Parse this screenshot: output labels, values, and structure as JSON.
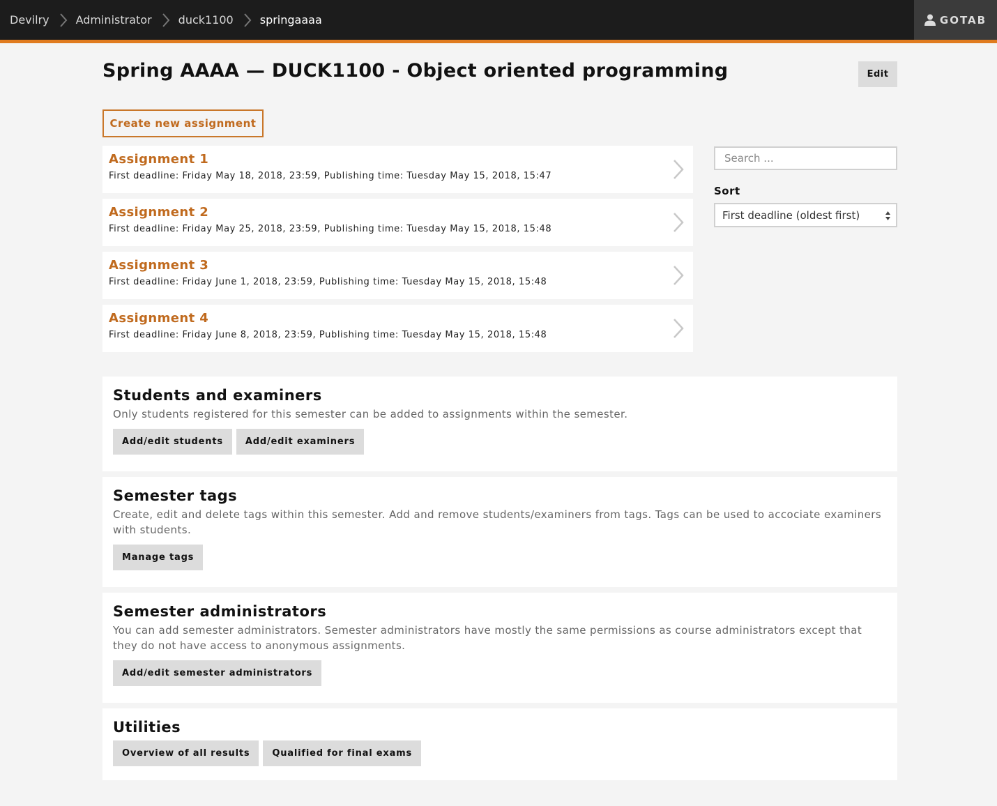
{
  "breadcrumbs": [
    {
      "label": "Devilry"
    },
    {
      "label": "Administrator"
    },
    {
      "label": "duck1100"
    },
    {
      "label": "springaaaa"
    }
  ],
  "user": {
    "label": "GOTAB",
    "icon": "user-icon"
  },
  "page": {
    "title": "Spring AAAA — DUCK1100 - Object oriented programming",
    "edit_label": "Edit",
    "create_label": "Create new assignment"
  },
  "assignments": [
    {
      "title": "Assignment 1",
      "meta": "First deadline: Friday May 18, 2018, 23:59, Publishing time: Tuesday May 15, 2018, 15:47"
    },
    {
      "title": "Assignment 2",
      "meta": "First deadline: Friday May 25, 2018, 23:59, Publishing time: Tuesday May 15, 2018, 15:48"
    },
    {
      "title": "Assignment 3",
      "meta": "First deadline: Friday June 1, 2018, 23:59, Publishing time: Tuesday May 15, 2018, 15:48"
    },
    {
      "title": "Assignment 4",
      "meta": "First deadline: Friday June 8, 2018, 23:59, Publishing time: Tuesday May 15, 2018, 15:48"
    }
  ],
  "sidebar": {
    "search_placeholder": "Search ...",
    "sort_label": "Sort",
    "sort_value": "First deadline (oldest first)"
  },
  "sections": {
    "students": {
      "title": "Students and examiners",
      "text": "Only students registered for this semester can be added to assignments within the semester.",
      "buttons": [
        "Add/edit students",
        "Add/edit examiners"
      ]
    },
    "tags": {
      "title": "Semester tags",
      "text": "Create, edit and delete tags within this semester. Add and remove students/examiners from tags. Tags can be used to accociate examiners with students.",
      "buttons": [
        "Manage tags"
      ]
    },
    "admins": {
      "title": "Semester administrators",
      "text": "You can add semester administrators. Semester administrators have mostly the same permissions as course administrators except that they do not have access to anonymous assignments.",
      "buttons": [
        "Add/edit semester administrators"
      ]
    },
    "utilities": {
      "title": "Utilities",
      "buttons": [
        "Overview of all results",
        "Qualified for final exams"
      ]
    }
  },
  "colors": {
    "topbar": "#1c1c1c",
    "accent": "#e07b1f",
    "link": "#c06a1e"
  }
}
